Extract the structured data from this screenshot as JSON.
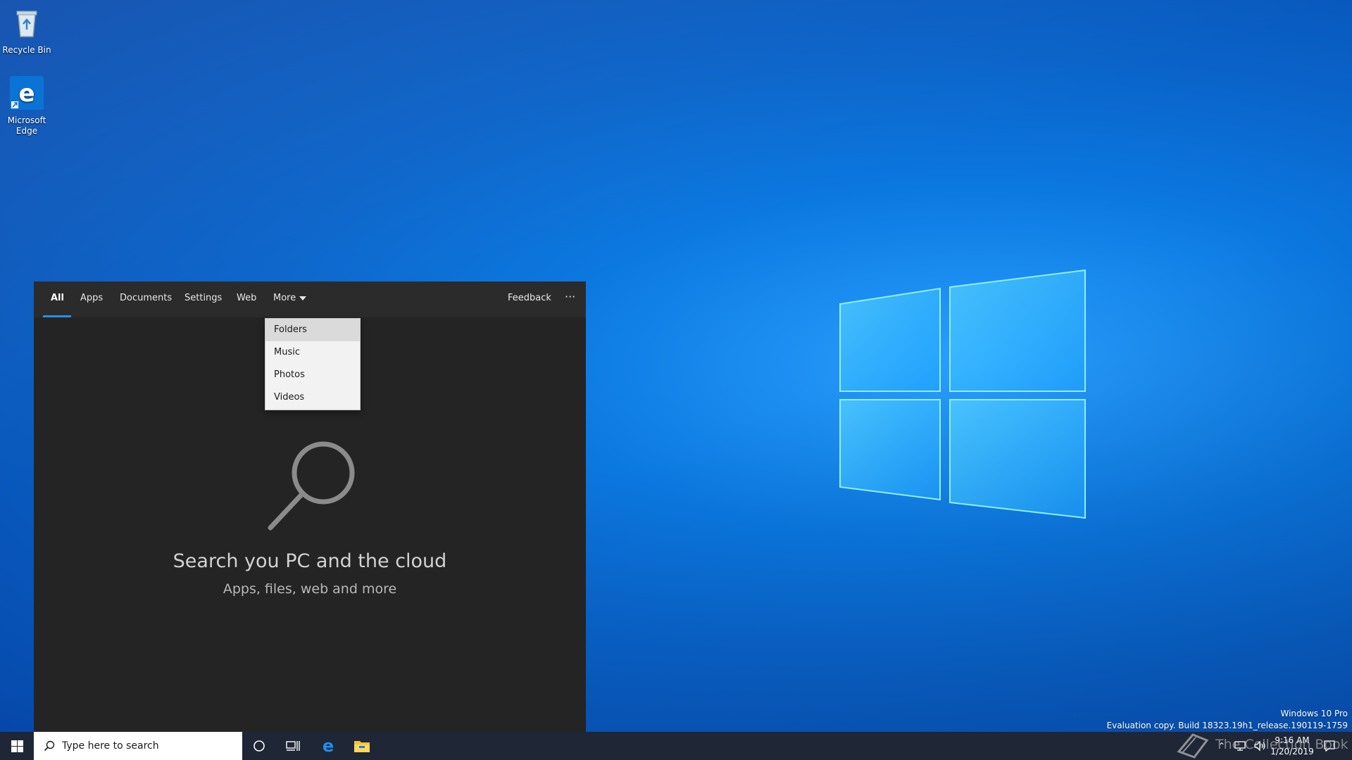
{
  "desktop": {
    "icons": [
      {
        "label": "Recycle Bin"
      },
      {
        "label": "Microsoft Edge"
      }
    ],
    "watermark": {
      "edition": "Windows 10 Pro",
      "build": "Evaluation copy. Build 18323.19h1_release.190119-1759"
    }
  },
  "search_panel": {
    "tabs": [
      {
        "label": "All",
        "active": true
      },
      {
        "label": "Apps"
      },
      {
        "label": "Documents"
      },
      {
        "label": "Settings"
      },
      {
        "label": "Web"
      },
      {
        "label": "More"
      }
    ],
    "feedback_label": "Feedback",
    "overflow_label": "···",
    "more_menu": [
      "Folders",
      "Music",
      "Photos",
      "Videos"
    ],
    "highlighted_item": "Folders",
    "hero_title": "Search you PC and the cloud",
    "hero_subtitle": "Apps, files, web and more"
  },
  "taskbar": {
    "search_placeholder": "Type here to search",
    "pinned": [
      "cortana-icon",
      "task-view-icon",
      "edge-icon",
      "file-explorer-icon"
    ],
    "tray": {
      "time": "9:16 AM",
      "date": "1/20/2019"
    },
    "brand_text": "The Collection Book"
  },
  "colors": {
    "panel_bg": "#242424",
    "tab_bar_bg": "#2b2b2b",
    "accent": "#2a8de8",
    "taskbar_bg": "#1f2636"
  }
}
